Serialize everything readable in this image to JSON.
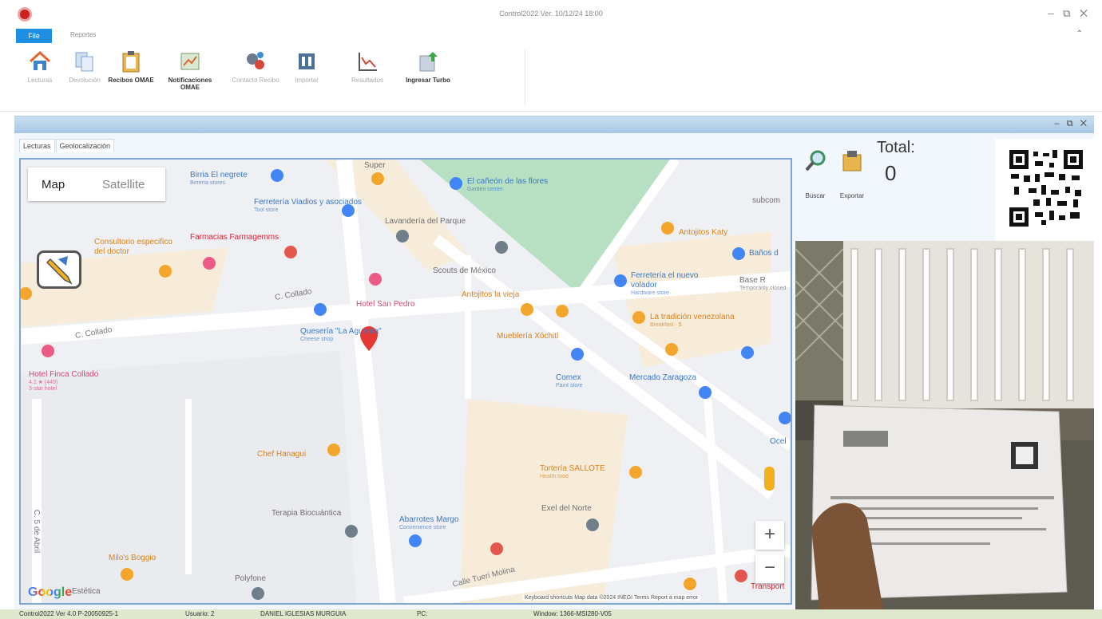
{
  "window": {
    "title": "Control2022  Ver. 10/12/24  18:00",
    "controls": "– ⧉ ✕"
  },
  "menu": {
    "file": "File",
    "reportes": "Reportes",
    "collapse": "⌃"
  },
  "ribbon": {
    "buttons": [
      {
        "label": "Lecturas",
        "icon": "house-icon"
      },
      {
        "label": "Devolución",
        "icon": "documents-icon"
      },
      {
        "label": "Recibos OMAE",
        "icon": "clipboard-icon"
      },
      {
        "label": "Notificaciones OMAE",
        "icon": "notification-chart-icon"
      },
      {
        "label": "Contacto Recibo",
        "icon": "gears-icon"
      },
      {
        "label": "Importar",
        "icon": "import-icon"
      },
      {
        "label": "Resultados",
        "icon": "line-chart-icon"
      },
      {
        "label": "Ingresar Turbo",
        "icon": "upload-icon"
      }
    ],
    "launcher": "↘"
  },
  "child": {
    "controls": "– ⧉ ✕"
  },
  "tabs": [
    {
      "label": "Lecturas"
    },
    {
      "label": "Geolocalización"
    }
  ],
  "map": {
    "maptype": {
      "map": "Map",
      "satellite": "Satellite"
    },
    "zoom_in": "+",
    "zoom_out": "−",
    "google": "Google",
    "attribution": "Keyboard shortcuts   Map data ©2024 INEGI   Terms   Report a map error",
    "roads": [
      "C. Collado",
      "C. Collado",
      "Calle Tueri Molina",
      "C. 5 de Abril"
    ],
    "pois": [
      {
        "name": "Birria El negrete",
        "sub": "Birrería stores"
      },
      {
        "name": "Ferretería Viadios y asociados",
        "sub": "Tool store"
      },
      {
        "name": "El cañeón de las flores",
        "sub": "Garden center"
      },
      {
        "name": "Lavandería del Parque",
        "sub": ""
      },
      {
        "name": "Consultorio especifico del doctor",
        "sub": ""
      },
      {
        "name": "Farmacias Farmagemms",
        "sub": ""
      },
      {
        "name": "Scouts de México",
        "sub": ""
      },
      {
        "name": "Antojitos Katy",
        "sub": ""
      },
      {
        "name": "Baños d",
        "sub": ""
      },
      {
        "name": "Ferretería el nuevo volador",
        "sub": "Hardware store"
      },
      {
        "name": "Base R",
        "sub": "Temporarily closed"
      },
      {
        "name": "Hotel San Pedro",
        "sub": ""
      },
      {
        "name": "Antojitos la vieja",
        "sub": ""
      },
      {
        "name": "La tradición venezolana",
        "sub": "Breakfast · $"
      },
      {
        "name": "Quesería \"La Aguanta\"",
        "sub": "Cheese shop"
      },
      {
        "name": "Mueblería Xóchitl",
        "sub": ""
      },
      {
        "name": "Hotel Finca Collado",
        "sub": "4.1 ★ (449)\n3-star hotel"
      },
      {
        "name": "Comex",
        "sub": "Paint store"
      },
      {
        "name": "Mercado Zaragoza",
        "sub": ""
      },
      {
        "name": "Chef Hanagui",
        "sub": ""
      },
      {
        "name": "Tortería SALLOTE",
        "sub": "Health food"
      },
      {
        "name": "Terapia Biocuántica",
        "sub": ""
      },
      {
        "name": "Abarrotes Margo",
        "sub": "Convenience store"
      },
      {
        "name": "Exel del Norte",
        "sub": ""
      },
      {
        "name": "Milo's Boggio",
        "sub": ""
      },
      {
        "name": "Polyfone",
        "sub": ""
      },
      {
        "name": "Estética",
        "sub": ""
      },
      {
        "name": "Super",
        "sub": ""
      },
      {
        "name": "subcom",
        "sub": ""
      },
      {
        "name": "Ocel",
        "sub": ""
      },
      {
        "name": "Transport",
        "sub": ""
      }
    ]
  },
  "tools": {
    "buscar": "Buscar",
    "exportar": "Exportar",
    "total_label": "Total:",
    "total_value": "0"
  },
  "status": [
    "Control2022  Ver 4.0  P-20050925-1",
    "Usuario:  2",
    "DANIEL IGLESIAS MURGUIA",
    "PC:",
    "Window: 1366-MSI280-V05"
  ],
  "colors": {
    "accent": "#1f8fe3",
    "mdi": "#a7c6e4",
    "map_border": "#7ea6d0",
    "status": "#dfe7cd",
    "park": "#b7dfc2"
  }
}
